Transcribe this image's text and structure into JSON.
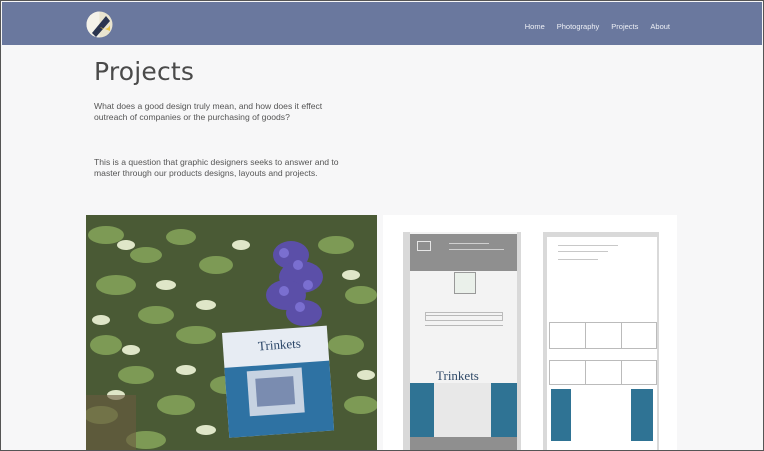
{
  "nav": {
    "items": [
      {
        "label": "Home"
      },
      {
        "label": "Photography"
      },
      {
        "label": "Projects"
      },
      {
        "label": "About"
      }
    ]
  },
  "page": {
    "title": "Projects",
    "intro_1": "What does a good design truly mean, and how does it effect outreach of companies or the purchasing of goods?",
    "intro_2": " This is a question that graphic designers seeks to answer and to master through our products designs, layouts and projects."
  },
  "gallery": {
    "photo_book_title": "Trinkets",
    "mockup_title": "Trinkets"
  },
  "colors": {
    "navbar": "#6a789e",
    "accent": "#2f7394",
    "background": "#f7f7f8"
  },
  "icons": {
    "logo": "half-moon-logo-icon"
  }
}
